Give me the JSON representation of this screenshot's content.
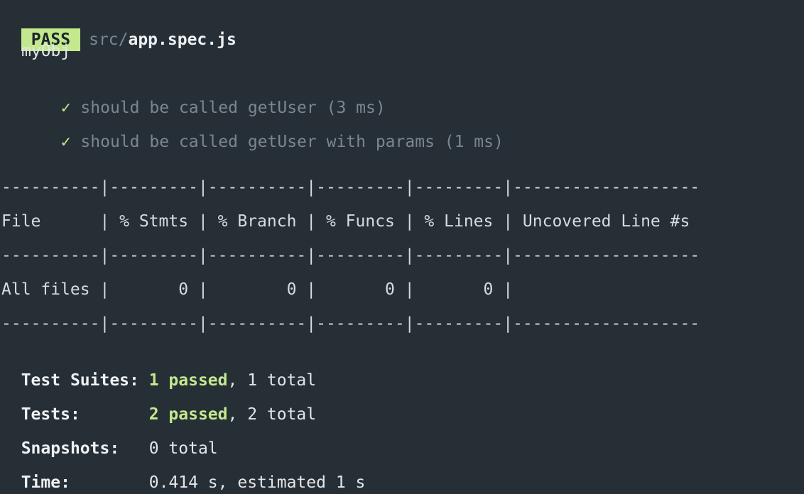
{
  "header": {
    "status": "PASS",
    "path_prefix": "src/",
    "filename": "app.spec.js"
  },
  "suite": {
    "name": "myObj",
    "tests": [
      {
        "check": "✓",
        "name": "should be called getUser (3 ms)"
      },
      {
        "check": "✓",
        "name": "should be called getUser with params (1 ms)"
      }
    ]
  },
  "coverage": {
    "separator": "----------|---------|----------|---------|---------|-------------------",
    "header_row": "File      | % Stmts | % Branch | % Funcs | % Lines | Uncovered Line #s ",
    "data_row": "All files |       0 |        0 |       0 |       0 |                   "
  },
  "summary": {
    "suites": {
      "label": "Test Suites: ",
      "passed": "1 passed",
      "rest": ", 1 total"
    },
    "tests": {
      "label": "Tests:       ",
      "passed": "2 passed",
      "rest": ", 2 total"
    },
    "snapshots": {
      "label": "Snapshots:   ",
      "value": "0 total"
    },
    "time": {
      "label": "Time:        ",
      "value": "0.414 s, estimated 1 s"
    }
  },
  "colors": {
    "background": "#262f36",
    "pass_green": "#c3e88d",
    "dim_text": "#7c8690"
  }
}
